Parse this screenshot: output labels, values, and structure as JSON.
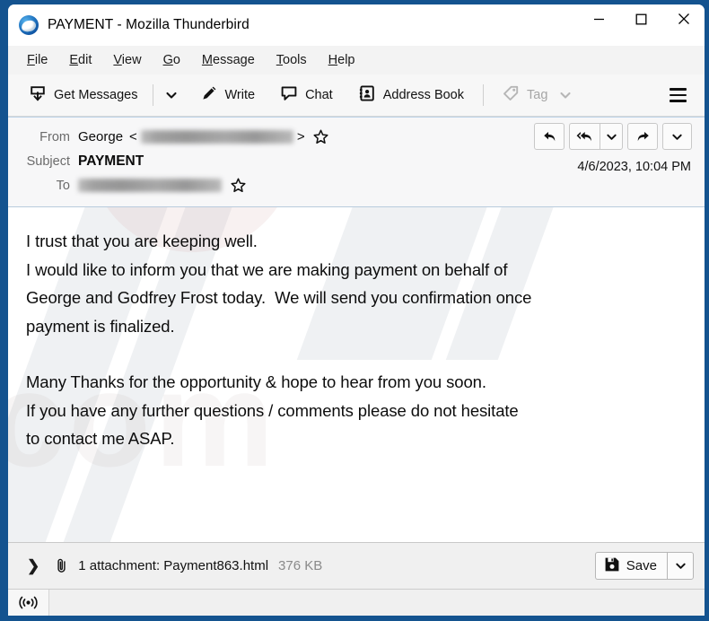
{
  "window": {
    "title": "PAYMENT - Mozilla Thunderbird",
    "app_icon": "thunderbird-logo-icon",
    "controls": {
      "minimize": "minimize-icon",
      "maximize": "maximize-icon",
      "close": "close-icon"
    }
  },
  "menu": {
    "items": [
      {
        "pre": "",
        "key": "F",
        "post": "ile"
      },
      {
        "pre": "",
        "key": "E",
        "post": "dit"
      },
      {
        "pre": "",
        "key": "V",
        "post": "iew"
      },
      {
        "pre": "",
        "key": "G",
        "post": "o"
      },
      {
        "pre": "",
        "key": "M",
        "post": "essage"
      },
      {
        "pre": "",
        "key": "T",
        "post": "ools"
      },
      {
        "pre": "",
        "key": "H",
        "post": "elp"
      }
    ]
  },
  "toolbar": {
    "get_messages_label": "Get Messages",
    "get_messages_dropdown": "chevron-down-icon",
    "write_label": "Write",
    "chat_label": "Chat",
    "address_book_label": "Address Book",
    "tag_label": "Tag",
    "tag_dropdown": "chevron-down-icon",
    "tag_disabled": true,
    "app_menu": "hamburger-icon"
  },
  "message_header": {
    "from_label": "From",
    "from_name": "George",
    "from_bracket_open": "<",
    "from_bracket_close": ">",
    "from_address_redacted": true,
    "subject_label": "Subject",
    "subject_value": "PAYMENT",
    "to_label": "To",
    "to_address_redacted": true,
    "date": "4/6/2023, 10:04 PM",
    "actions": {
      "reply": "reply-icon",
      "reply_all": "reply-all-icon",
      "reply_all_dropdown": "chevron-down-icon",
      "forward": "forward-icon",
      "more": "chevron-down-icon"
    }
  },
  "message_body": {
    "paragraph_1": "I trust that you are keeping well.\nI would like to inform you that we are making payment on behalf of\nGeorge and Godfrey Frost today.  We will send you confirmation once\npayment is finalized.",
    "paragraph_2": "Many Thanks for the opportunity & hope to hear from you soon.\nIf you have any further questions / comments please do not hesitate\nto contact me ASAP."
  },
  "attachment": {
    "expander": "❯",
    "paperclip": "paperclip-icon",
    "label": "1 attachment: Payment863.html",
    "size": "376 KB",
    "save_label": "Save",
    "save_icon": "floppy-disk-icon",
    "save_dropdown": "chevron-down-icon"
  },
  "status_bar": {
    "online_icon": "broadcast-online-icon",
    "text": ""
  },
  "colors": {
    "window_border": "#14538f",
    "toolbar_bg": "#f7f7f7",
    "header_bg": "#f7f7f8",
    "accent_line": "#bcd3e8",
    "disabled_text": "#a6a6a6",
    "size_text": "#8a8a8a"
  }
}
